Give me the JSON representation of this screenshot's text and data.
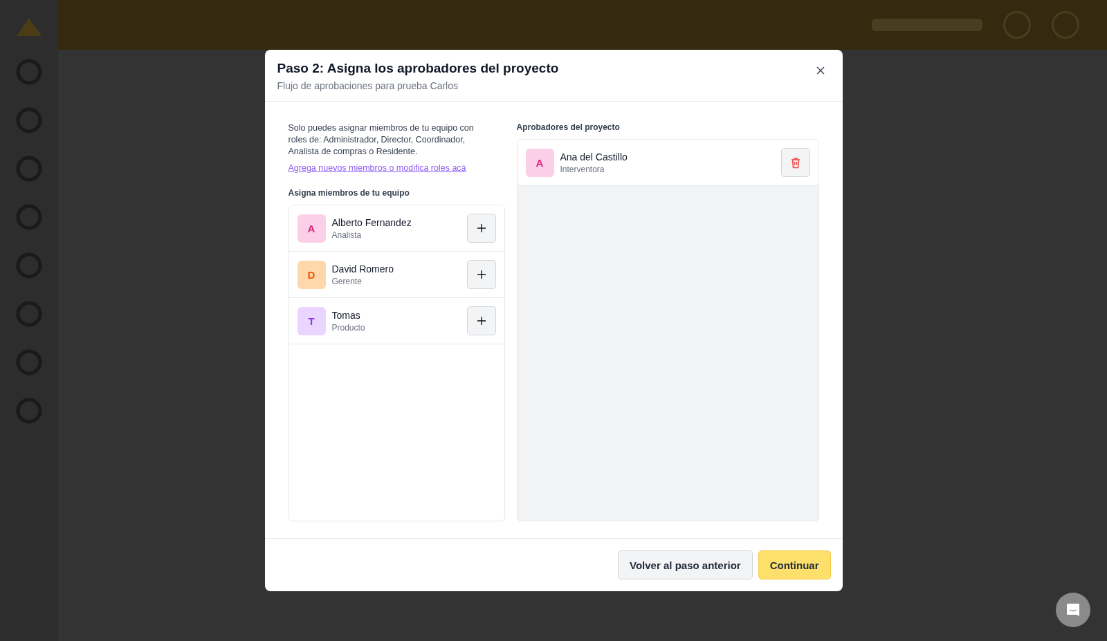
{
  "dialog": {
    "title": "Paso 2: Asigna los aprobadores del proyecto",
    "subtitle": "Flujo de aprobaciones para prueba Carlos",
    "info_text": "Solo puedes asignar miembros de tu equipo con roles de: Administrador, Director, Coordinador, Analista de compras o Residente.",
    "link": "Agrega nuevos miembros o modifica roles acá",
    "team_heading": "Asigna miembros de tu equipo",
    "team_members": [
      {
        "initial": "A",
        "name": "Alberto Fernandez",
        "role": "Analista",
        "color": "#db2777"
      },
      {
        "initial": "D",
        "name": "David Romero",
        "role": "Gerente",
        "color": "#ea580c"
      },
      {
        "initial": "T",
        "name": "Tomas",
        "role": "Producto",
        "color": "#9333ea"
      }
    ],
    "approvers_heading": "Aprobadores del proyecto",
    "approvers": [
      {
        "initial": "A",
        "name": "Ana del Castillo",
        "role": "Interventora",
        "color": "#db2777"
      }
    ],
    "buttons": [
      {
        "label": "Volver al paso anterior",
        "kind": "secondary"
      },
      {
        "label": "Continuar",
        "kind": "primary"
      }
    ]
  }
}
